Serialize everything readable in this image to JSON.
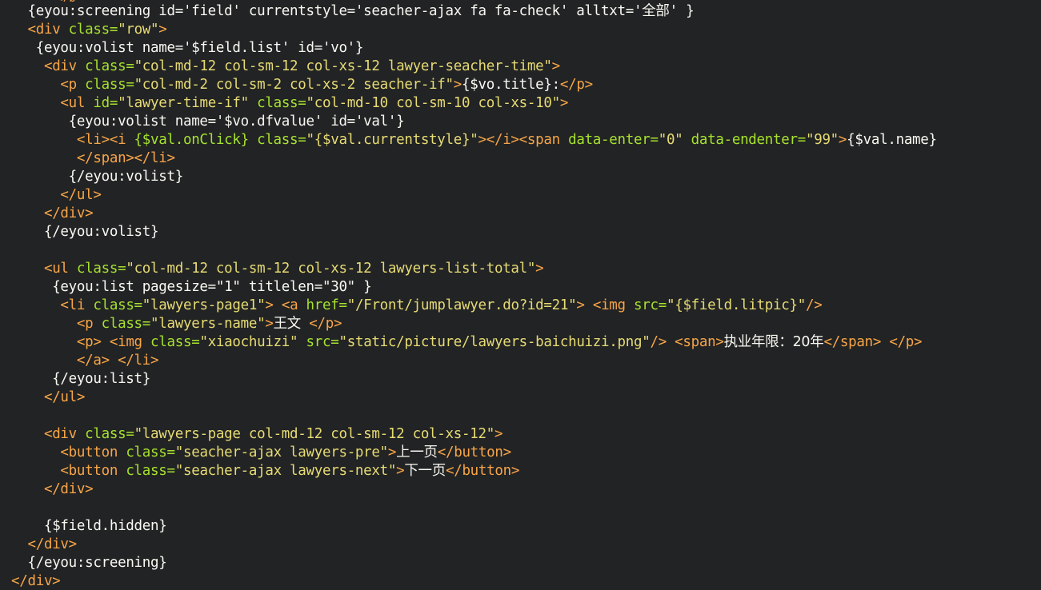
{
  "editor": {
    "theme": {
      "background": "#222324",
      "text": "#f8f8f2",
      "tag": "#f7a548",
      "attr": "#a6e22e",
      "string": "#e6db74"
    },
    "lines": [
      {
        "indent": "  ",
        "tokens": [
          {
            "t": "tx",
            "v": "{eyou:screening id='field' currentstyle='seacher-ajax fa fa-check' alltxt='"
          },
          {
            "t": "tx",
            "v": "全部",
            "cjk": true
          },
          {
            "t": "tx",
            "v": "' }"
          }
        ]
      },
      {
        "indent": "  ",
        "tokens": [
          {
            "t": "tg",
            "v": "<div "
          },
          {
            "t": "at",
            "v": "class="
          },
          {
            "t": "st",
            "v": "\"row\""
          },
          {
            "t": "tg",
            "v": ">"
          }
        ]
      },
      {
        "indent": "   ",
        "tokens": [
          {
            "t": "tx",
            "v": "{eyou:volist name='$field.list' id='vo'}"
          }
        ]
      },
      {
        "indent": "    ",
        "tokens": [
          {
            "t": "tg",
            "v": "<div "
          },
          {
            "t": "at",
            "v": "class="
          },
          {
            "t": "st",
            "v": "\"col-md-12 col-sm-12 col-xs-12 lawyer-seacher-time\""
          },
          {
            "t": "tg",
            "v": ">"
          }
        ]
      },
      {
        "indent": "      ",
        "tokens": [
          {
            "t": "tg",
            "v": "<p "
          },
          {
            "t": "at",
            "v": "class="
          },
          {
            "t": "st",
            "v": "\"col-md-2 col-sm-2 col-xs-2 seacher-if\""
          },
          {
            "t": "tg",
            "v": ">"
          },
          {
            "t": "tx",
            "v": "{$vo.title}:"
          },
          {
            "t": "tg",
            "v": "</p>"
          }
        ]
      },
      {
        "indent": "      ",
        "tokens": [
          {
            "t": "tg",
            "v": "<ul "
          },
          {
            "t": "at",
            "v": "id="
          },
          {
            "t": "st",
            "v": "\"lawyer-time-if\" "
          },
          {
            "t": "at",
            "v": "class="
          },
          {
            "t": "st",
            "v": "\"col-md-10 col-sm-10 col-xs-10\""
          },
          {
            "t": "tg",
            "v": ">"
          }
        ]
      },
      {
        "indent": "       ",
        "tokens": [
          {
            "t": "tx",
            "v": "{eyou:volist name='$vo.dfvalue' id='val'}"
          }
        ]
      },
      {
        "indent": "        ",
        "tokens": [
          {
            "t": "tg",
            "v": "<li><i "
          },
          {
            "t": "at",
            "v": "{$val.onClick} class="
          },
          {
            "t": "st",
            "v": "\"{$val.currentstyle}\""
          },
          {
            "t": "tg",
            "v": "></i><span "
          },
          {
            "t": "at",
            "v": "data-enter="
          },
          {
            "t": "st",
            "v": "\"0\" "
          },
          {
            "t": "at",
            "v": "data-endenter="
          },
          {
            "t": "st",
            "v": "\"99\""
          },
          {
            "t": "tg",
            "v": ">"
          },
          {
            "t": "tx",
            "v": "{$val.name}"
          }
        ]
      },
      {
        "indent": "        ",
        "tokens": [
          {
            "t": "tg",
            "v": "</span></li>"
          }
        ]
      },
      {
        "indent": "       ",
        "tokens": [
          {
            "t": "tx",
            "v": "{/eyou:volist}"
          }
        ]
      },
      {
        "indent": "      ",
        "tokens": [
          {
            "t": "tg",
            "v": "</ul>"
          }
        ]
      },
      {
        "indent": "    ",
        "tokens": [
          {
            "t": "tg",
            "v": "</div>"
          }
        ]
      },
      {
        "indent": "    ",
        "tokens": [
          {
            "t": "tx",
            "v": "{/eyou:volist}"
          }
        ]
      },
      {
        "indent": "",
        "tokens": []
      },
      {
        "indent": "    ",
        "tokens": [
          {
            "t": "tg",
            "v": "<ul "
          },
          {
            "t": "at",
            "v": "class="
          },
          {
            "t": "st",
            "v": "\"col-md-12 col-sm-12 col-xs-12 lawyers-list-total\""
          },
          {
            "t": "tg",
            "v": ">"
          }
        ]
      },
      {
        "indent": "     ",
        "tokens": [
          {
            "t": "tx",
            "v": "{eyou:list pagesize=\"1\" titlelen=\"30\" }"
          }
        ]
      },
      {
        "indent": "      ",
        "tokens": [
          {
            "t": "tg",
            "v": "<li "
          },
          {
            "t": "at",
            "v": "class="
          },
          {
            "t": "st",
            "v": "\"lawyers-page1\""
          },
          {
            "t": "tg",
            "v": "> "
          },
          {
            "t": "tg",
            "v": "<a "
          },
          {
            "t": "at",
            "v": "href="
          },
          {
            "t": "st",
            "v": "\"/Front/jumplawyer.do?id=21\""
          },
          {
            "t": "tg",
            "v": "> "
          },
          {
            "t": "tg",
            "v": "<img "
          },
          {
            "t": "at",
            "v": "src="
          },
          {
            "t": "st",
            "v": "\"{$field.litpic}\""
          },
          {
            "t": "tg",
            "v": "/>"
          }
        ]
      },
      {
        "indent": "        ",
        "tokens": [
          {
            "t": "tg",
            "v": "<p "
          },
          {
            "t": "at",
            "v": "class="
          },
          {
            "t": "st",
            "v": "\"lawyers-name\""
          },
          {
            "t": "tg",
            "v": ">"
          },
          {
            "t": "tx",
            "v": "王文",
            "cjk": true
          },
          {
            "t": "tx",
            "v": " "
          },
          {
            "t": "tg",
            "v": "</p>"
          }
        ]
      },
      {
        "indent": "        ",
        "tokens": [
          {
            "t": "tg",
            "v": "<p> "
          },
          {
            "t": "tg",
            "v": "<img "
          },
          {
            "t": "at",
            "v": "class="
          },
          {
            "t": "st",
            "v": "\"xiaochuizi\" "
          },
          {
            "t": "at",
            "v": "src="
          },
          {
            "t": "st",
            "v": "\"static/picture/lawyers-baichuizi.png\""
          },
          {
            "t": "tg",
            "v": "/> <span>"
          },
          {
            "t": "tx",
            "v": "执业年限：20年",
            "cjk": true
          },
          {
            "t": "tg",
            "v": "</span> </p>"
          }
        ]
      },
      {
        "indent": "        ",
        "tokens": [
          {
            "t": "tg",
            "v": "</a> </li>"
          }
        ]
      },
      {
        "indent": "     ",
        "tokens": [
          {
            "t": "tx",
            "v": "{/eyou:list}"
          }
        ]
      },
      {
        "indent": "    ",
        "tokens": [
          {
            "t": "tg",
            "v": "</ul>"
          }
        ]
      },
      {
        "indent": "",
        "tokens": []
      },
      {
        "indent": "    ",
        "tokens": [
          {
            "t": "tg",
            "v": "<div "
          },
          {
            "t": "at",
            "v": "class="
          },
          {
            "t": "st",
            "v": "\"lawyers-page col-md-12 col-sm-12 col-xs-12\""
          },
          {
            "t": "tg",
            "v": ">"
          }
        ]
      },
      {
        "indent": "      ",
        "tokens": [
          {
            "t": "tg",
            "v": "<button "
          },
          {
            "t": "at",
            "v": "class="
          },
          {
            "t": "st",
            "v": "\"seacher-ajax lawyers-pre\""
          },
          {
            "t": "tg",
            "v": ">"
          },
          {
            "t": "tx",
            "v": "上一页",
            "cjk": true
          },
          {
            "t": "tg",
            "v": "</button>"
          }
        ]
      },
      {
        "indent": "      ",
        "tokens": [
          {
            "t": "tg",
            "v": "<button "
          },
          {
            "t": "at",
            "v": "class="
          },
          {
            "t": "st",
            "v": "\"seacher-ajax lawyers-next\""
          },
          {
            "t": "tg",
            "v": ">"
          },
          {
            "t": "tx",
            "v": "下一页",
            "cjk": true
          },
          {
            "t": "tg",
            "v": "</button>"
          }
        ]
      },
      {
        "indent": "    ",
        "tokens": [
          {
            "t": "tg",
            "v": "</div>"
          }
        ]
      },
      {
        "indent": "",
        "tokens": []
      },
      {
        "indent": "    ",
        "tokens": [
          {
            "t": "tx",
            "v": "{$field.hidden}"
          }
        ]
      },
      {
        "indent": "  ",
        "tokens": [
          {
            "t": "tg",
            "v": "</div>"
          }
        ]
      },
      {
        "indent": "  ",
        "tokens": [
          {
            "t": "tx",
            "v": "{/eyou:screening}"
          }
        ]
      },
      {
        "indent": "",
        "tokens": [
          {
            "t": "tg",
            "v": "</div>"
          }
        ]
      }
    ]
  }
}
